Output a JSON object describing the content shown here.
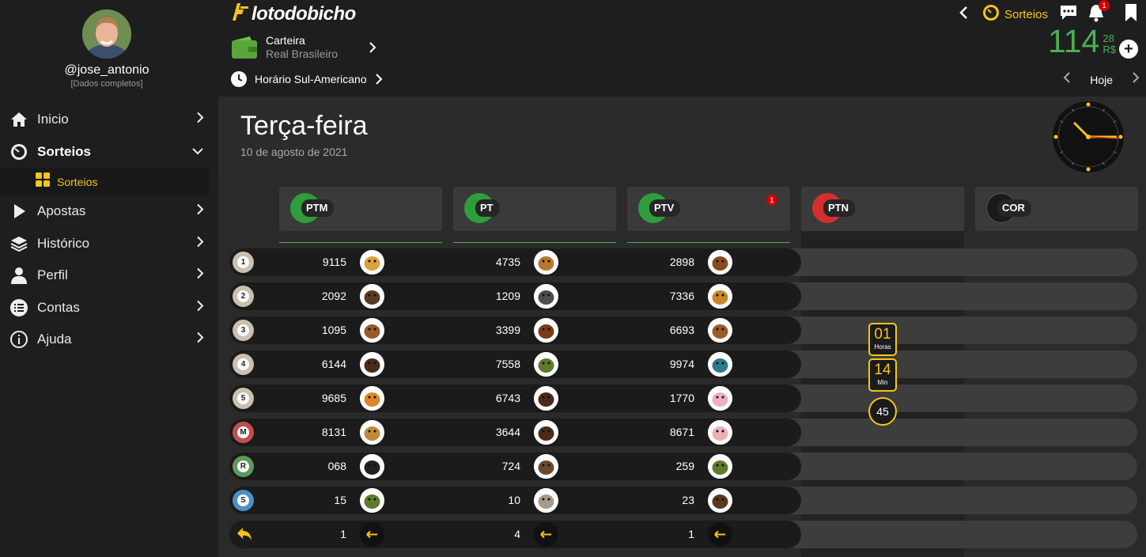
{
  "user": {
    "handle": "@jose_antonio",
    "status": "[Dados completos]"
  },
  "logo": {
    "text": "lotodobicho"
  },
  "wallet": {
    "title": "Carteira",
    "currency": "Real Brasileiro"
  },
  "timezone": {
    "label": "Horário Sul-Americano"
  },
  "header": {
    "sorteios_label": "Sorteios",
    "notification_count": "1"
  },
  "balance": {
    "integer": "114",
    "cents": "28",
    "currency": "R$",
    "add_label": "+"
  },
  "day_nav": {
    "label": "Hoje"
  },
  "menu": [
    {
      "label": "Inicio",
      "icon": "home-icon"
    },
    {
      "label": "Sorteios",
      "icon": "timer-icon"
    },
    {
      "label": "Apostas",
      "icon": "play-icon"
    },
    {
      "label": "Histórico",
      "icon": "layers-icon"
    },
    {
      "label": "Perfil",
      "icon": "user-icon"
    },
    {
      "label": "Contas",
      "icon": "list-icon"
    },
    {
      "label": "Ajuda",
      "icon": "info-icon"
    }
  ],
  "submenu": {
    "label": "Sorteios",
    "icon": "grid-icon"
  },
  "day": {
    "name": "Terça-feira",
    "date": "10 de agosto de 2021"
  },
  "columns": [
    {
      "code": "PTM",
      "color": "#2e9e3a",
      "notif": ""
    },
    {
      "code": "PT",
      "color": "#2e9e3a",
      "notif": ""
    },
    {
      "code": "PTV",
      "color": "#2e9e3a",
      "notif": "1"
    },
    {
      "code": "PTN",
      "color": "#d32f2f",
      "notif": ""
    },
    {
      "code": "COR",
      "color": "#222222",
      "notif": ""
    }
  ],
  "rows": [
    {
      "ball": "1",
      "ball_color": "#c9c0b0",
      "values": [
        "9115",
        "4735",
        "2898"
      ],
      "animals": [
        "butterfly-icon",
        "dog-icon",
        "cow-icon"
      ]
    },
    {
      "ball": "2",
      "ball_color": "#c9c0b0",
      "values": [
        "2092",
        "1209",
        "7336"
      ],
      "animals": [
        "bear-icon",
        "donkey-icon",
        "lion-icon"
      ]
    },
    {
      "ball": "3",
      "ball_color": "#c9c0b0",
      "values": [
        "1095",
        "3399",
        "6693"
      ],
      "animals": [
        "deer-icon",
        "bull-icon",
        "deer-icon"
      ]
    },
    {
      "ball": "4",
      "ball_color": "#c9c0b0",
      "values": [
        "6144",
        "7558",
        "9974"
      ],
      "animals": [
        "horse-icon",
        "alligator-icon",
        "peacock-icon"
      ]
    },
    {
      "ball": "5",
      "ball_color": "#c9c0b0",
      "values": [
        "9685",
        "6743",
        "1770"
      ],
      "animals": [
        "tiger-icon",
        "horse-icon",
        "pig-icon"
      ]
    },
    {
      "ball": "M",
      "ball_color": "#c0504d",
      "values": [
        "8131",
        "3644",
        "8671"
      ],
      "animals": [
        "camel-icon",
        "horse-icon",
        "pig-icon"
      ]
    },
    {
      "ball": "R",
      "ball_color": "#5c9a5c",
      "values": [
        "068",
        "724",
        "259"
      ],
      "animals": [
        "ostrich-icon",
        "goat-icon",
        "alligator-icon"
      ]
    },
    {
      "ball": "S",
      "ball_color": "#4a90c8",
      "values": [
        "15",
        "10",
        "23"
      ],
      "animals": [
        "alligator-icon",
        "rabbit-icon",
        "bear-icon"
      ]
    }
  ],
  "back_row": {
    "values": [
      "1",
      "4",
      "1"
    ]
  },
  "countdown": {
    "hours": "01",
    "hours_label": "Horas",
    "minutes": "14",
    "minutes_label": "Min",
    "seconds": "45"
  }
}
